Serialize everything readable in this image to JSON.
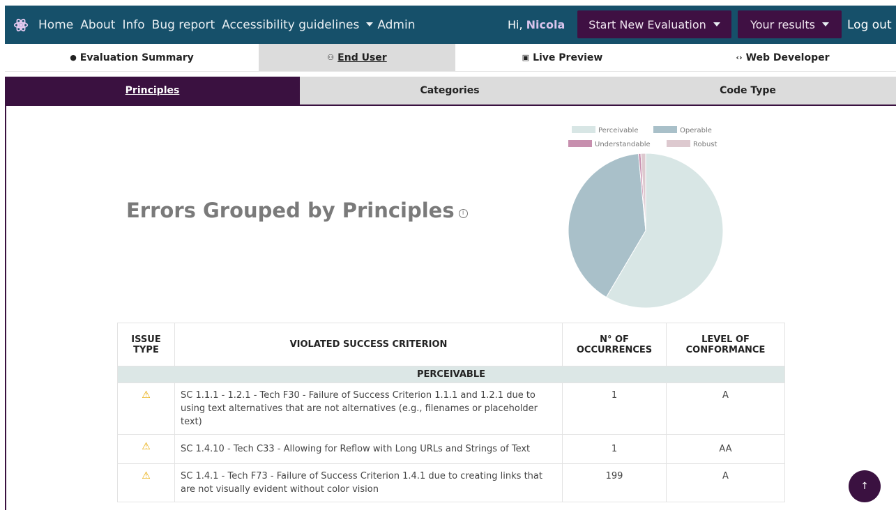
{
  "nav": {
    "links": [
      "Home",
      "About",
      "Info",
      "Bug report",
      "Accessibility guidelines"
    ],
    "admin": "Admin",
    "greeting_prefix": "Hi,",
    "user_name": "Nicola",
    "start_evaluation": "Start New Evaluation",
    "your_results": "Your results",
    "logout": "Log out"
  },
  "main_tabs": [
    {
      "icon": "info-circle-icon",
      "label": "Evaluation Summary"
    },
    {
      "icon": "users-icon",
      "label": "End User"
    },
    {
      "icon": "preview-icon",
      "label": "Live Preview"
    },
    {
      "icon": "code-icon",
      "label": "Web Developer"
    }
  ],
  "sub_tabs": [
    "Principles",
    "Categories",
    "Code Type"
  ],
  "heading": "Errors Grouped by Principles",
  "chart_data": {
    "type": "pie",
    "legend": [
      "Perceivable",
      "Operable",
      "Understandable",
      "Robust"
    ],
    "colors": [
      "#d8e6e5",
      "#a9c0c9",
      "#c78fae",
      "#ddc9cf"
    ],
    "values": [
      58.5,
      40.0,
      0.5,
      1.0
    ],
    "legend_position": "top"
  },
  "table": {
    "headers": [
      "ISSUE TYPE",
      "VIOLATED SUCCESS CRITERION",
      "N° OF OCCURRENCES",
      "LEVEL OF CONFORMANCE"
    ],
    "group": "PERCEIVABLE",
    "rows": [
      {
        "criterion": "SC 1.1.1 - 1.2.1 - Tech F30 - Failure of Success Criterion 1.1.1 and 1.2.1 due to using text alternatives that are not alternatives (e.g., filenames or placeholder text)",
        "occurrences": "1",
        "level": "A"
      },
      {
        "criterion": "SC 1.4.10 - Tech C33 - Allowing for Reflow with Long URLs and Strings of Text",
        "occurrences": "1",
        "level": "AA"
      },
      {
        "criterion": "SC 1.4.1 - Tech F73 - Failure of Success Criterion 1.4.1 due to creating links that are not visually evident without color vision",
        "occurrences": "199",
        "level": "A"
      }
    ]
  }
}
